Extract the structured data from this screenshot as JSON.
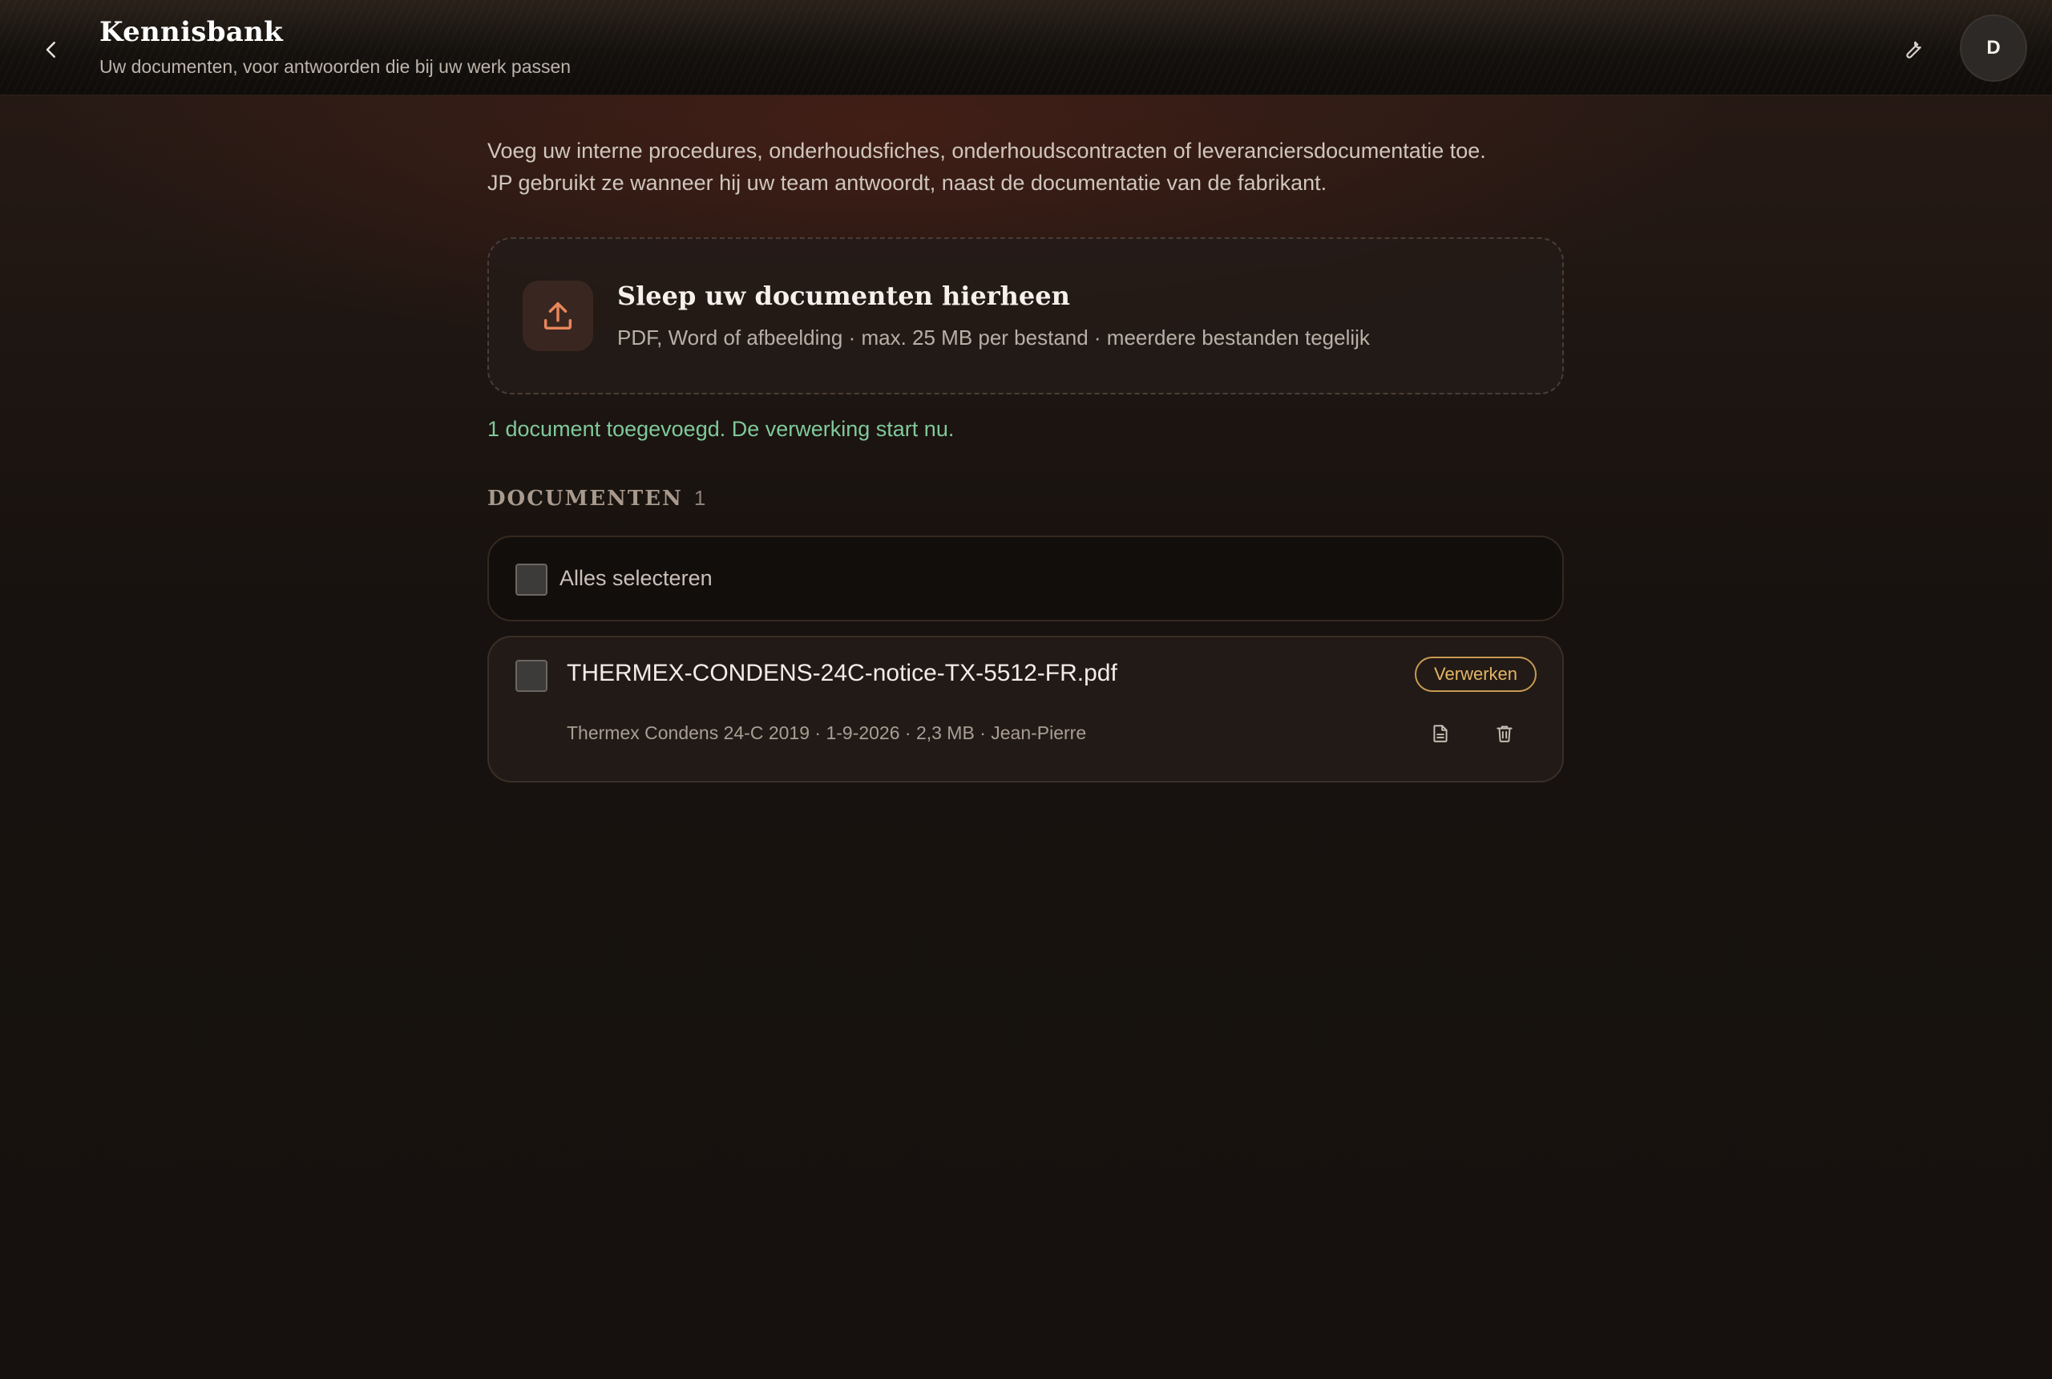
{
  "header": {
    "title": "Kennisbank",
    "subtitle": "Uw documenten, voor antwoorden die bij uw werk passen",
    "avatar_initial": "D",
    "back_icon": "chevron-left-icon",
    "tools_icon": "wrench-icon"
  },
  "intro": {
    "line1": "Voeg uw interne procedures, onderhoudsfiches, onderhoudscontracten of leveranciersdocumentatie toe.",
    "line2": "JP gebruikt ze wanneer hij uw team antwoordt, naast de documentatie van de fabrikant."
  },
  "dropzone": {
    "icon": "upload-icon",
    "title": "Sleep uw documenten hierheen",
    "subtitle": "PDF, Word of afbeelding · max. 25 MB per bestand · meerdere bestanden tegelijk"
  },
  "status_message": "1 document toegevoegd. De verwerking start nu.",
  "documents": {
    "heading": "DOCUMENTEN",
    "count": "1",
    "select_all_label": "Alles selecteren",
    "items": [
      {
        "filename": "THERMEX-CONDENS-24C-notice-TX-5512-FR.pdf",
        "meta": "Thermex Condens 24-C 2019 · 1-9-2026 · 2,3 MB · Jean-Pierre",
        "action_label": "Verwerken"
      }
    ]
  },
  "colors": {
    "accent_orange": "#e8875a",
    "status_green": "#7fc99a",
    "process_gold": "#e4b565",
    "background": "#17120f"
  }
}
